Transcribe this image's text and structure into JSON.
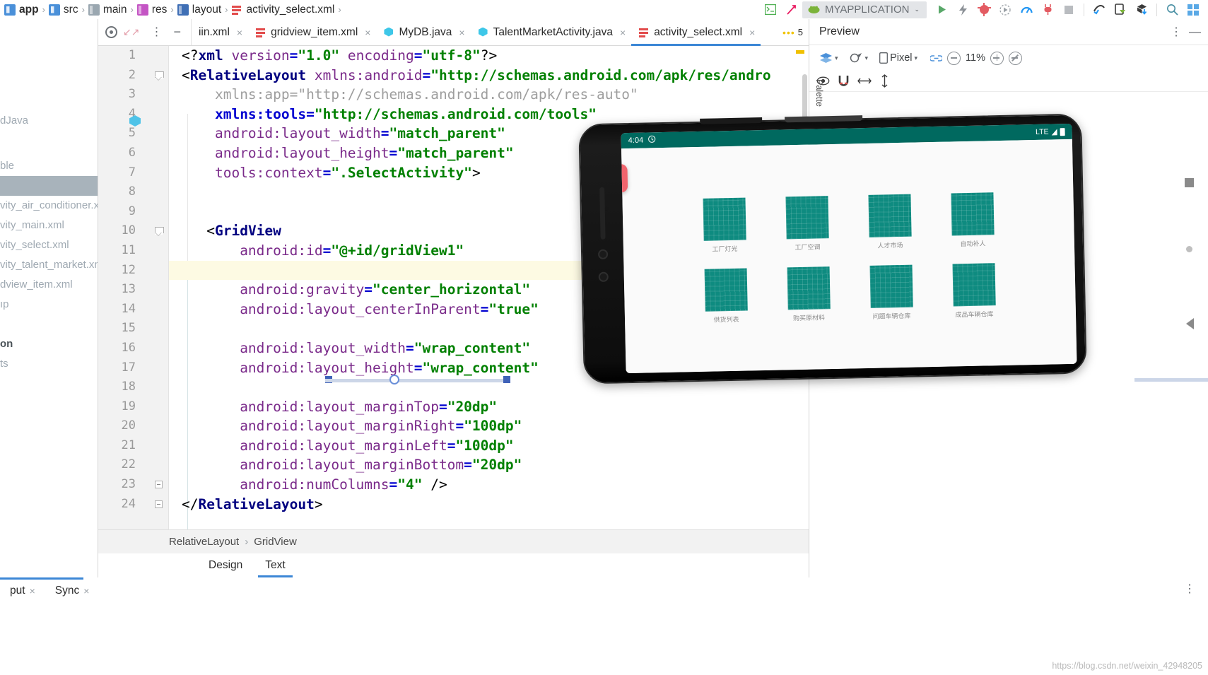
{
  "breadcrumb": {
    "items": [
      {
        "label": "app",
        "icon": "module-icon",
        "bold": true
      },
      {
        "label": "src",
        "icon": "module-icon",
        "bold": false
      },
      {
        "label": "main",
        "icon": "folder-icon",
        "bold": false
      },
      {
        "label": "res",
        "icon": "res-folder-icon",
        "bold": false
      },
      {
        "label": "layout",
        "icon": "layout-folder-icon",
        "bold": false
      },
      {
        "label": "activity_select.xml",
        "icon": "xml-file-icon",
        "bold": false
      }
    ],
    "separator": "›"
  },
  "toolbar": {
    "run_config_name": "MYAPPLICATION",
    "dropdown_caret": "⌄",
    "icons": [
      "terminal-icon",
      "build-icon",
      "android-icon",
      "run-icon",
      "apply-changes-icon",
      "debug-icon",
      "profile-icon",
      "attach-debugger-icon",
      "stop-icon",
      "sdk-manager-icon",
      "avd-manager-icon",
      "sync-gradle-icon",
      "search-icon",
      "layout-inspector-icon"
    ]
  },
  "sidebar": {
    "items": [
      {
        "label": "dJava",
        "selected": false,
        "bold": false
      },
      {
        "label": "",
        "selected": false,
        "bold": false
      },
      {
        "label": "ble",
        "selected": false,
        "bold": false
      },
      {
        "label": "",
        "selected": true,
        "bold": false
      },
      {
        "label": "vity_air_conditioner.x",
        "selected": false,
        "bold": false
      },
      {
        "label": "vity_main.xml",
        "selected": false,
        "bold": false
      },
      {
        "label": "vity_select.xml",
        "selected": false,
        "bold": false
      },
      {
        "label": "vity_talent_market.xn",
        "selected": false,
        "bold": false
      },
      {
        "label": "dview_item.xml",
        "selected": false,
        "bold": false
      },
      {
        "label": "ıp",
        "selected": false,
        "bold": false
      },
      {
        "label": "",
        "selected": false,
        "bold": false
      },
      {
        "label": "on",
        "selected": false,
        "bold": true
      },
      {
        "label": "ts",
        "selected": false,
        "bold": false
      }
    ]
  },
  "editor": {
    "tabs": [
      {
        "label": "iin.xml",
        "icon": "xml-file-icon",
        "active": false,
        "close": "×"
      },
      {
        "label": "gridview_item.xml",
        "icon": "xml-file-icon",
        "active": false,
        "close": "×"
      },
      {
        "label": "MyDB.java",
        "icon": "java-file-icon",
        "active": false,
        "close": "×"
      },
      {
        "label": "TalentMarketActivity.java",
        "icon": "java-file-icon",
        "active": false,
        "close": "×"
      },
      {
        "label": "activity_select.xml",
        "icon": "xml-file-icon",
        "active": true,
        "close": "×"
      }
    ],
    "warning_count": "5",
    "warning_dots": "•••",
    "line_numbers": [
      "1",
      "2",
      "3",
      "4",
      "5",
      "6",
      "7",
      "8",
      "9",
      "10",
      "11",
      "12",
      "13",
      "14",
      "15",
      "16",
      "17",
      "18",
      "19",
      "20",
      "21",
      "22",
      "23",
      "24"
    ],
    "lines": [
      {
        "n": 1,
        "highlight": false,
        "html": "<span class=\"tk-pl\">&lt;?</span><span class=\"tk-tag\">xml</span> <span class=\"tk-attr\">version</span><span class=\"tk-eq\">=</span><span class=\"tk-val\">\"1.0\"</span> <span class=\"tk-attr\">encoding</span><span class=\"tk-eq\">=</span><span class=\"tk-val\">\"utf-8\"</span><span class=\"tk-pl\">?&gt;</span>"
      },
      {
        "n": 2,
        "highlight": false,
        "html": "<span class=\"tk-pl\">&lt;</span><span class=\"tk-tag\">RelativeLayout</span> <span class=\"tk-attr\">xmlns:android</span><span class=\"tk-eq\">=</span><span class=\"tk-val\">\"http://schemas.android.com/apk/res/andro</span>"
      },
      {
        "n": 3,
        "highlight": false,
        "html": "    <span class=\"tk-ns\">xmlns:app=\"http://schemas.android.com/apk/res-auto\"</span>"
      },
      {
        "n": 4,
        "highlight": false,
        "html": "    <span class=\"tk-eq\">xmlns:tools</span><span class=\"tk-eq\">=</span><span class=\"tk-val\">\"http://schemas.android.com/tools\"</span>"
      },
      {
        "n": 5,
        "highlight": false,
        "html": "    <span class=\"tk-attr\">android:layout_width</span><span class=\"tk-eq\">=</span><span class=\"tk-val\">\"match_parent\"</span>"
      },
      {
        "n": 6,
        "highlight": false,
        "html": "    <span class=\"tk-attr\">android:layout_height</span><span class=\"tk-eq\">=</span><span class=\"tk-val\">\"match_parent\"</span>"
      },
      {
        "n": 7,
        "highlight": false,
        "html": "    <span class=\"tk-attr\">tools:context</span><span class=\"tk-eq\">=</span><span class=\"tk-val\">\".SelectActivity\"</span><span class=\"tk-pl\">&gt;</span>"
      },
      {
        "n": 8,
        "highlight": false,
        "html": ""
      },
      {
        "n": 9,
        "highlight": false,
        "html": ""
      },
      {
        "n": 10,
        "highlight": false,
        "html": "   <span class=\"tk-pl\">&lt;</span><span class=\"tk-tag\">GridView</span>"
      },
      {
        "n": 11,
        "highlight": false,
        "html": "       <span class=\"tk-attr\">android:id</span><span class=\"tk-eq\">=</span><span class=\"tk-val\">\"@+id/gridView1\"</span>"
      },
      {
        "n": 12,
        "highlight": true,
        "html": ""
      },
      {
        "n": 13,
        "highlight": false,
        "html": "       <span class=\"tk-attr\">android:gravity</span><span class=\"tk-eq\">=</span><span class=\"tk-val\">\"center_horizontal\"</span>"
      },
      {
        "n": 14,
        "highlight": false,
        "html": "       <span class=\"tk-attr\">android:layout_centerInParent</span><span class=\"tk-eq\">=</span><span class=\"tk-val\">\"true\"</span>"
      },
      {
        "n": 15,
        "highlight": false,
        "html": ""
      },
      {
        "n": 16,
        "highlight": false,
        "html": "       <span class=\"tk-attr\">android:layout_width</span><span class=\"tk-eq\">=</span><span class=\"tk-val\">\"wrap_content\"</span>"
      },
      {
        "n": 17,
        "highlight": false,
        "html": "       <span class=\"tk-attr\">android:layout_height</span><span class=\"tk-eq\">=</span><span class=\"tk-val\">\"wrap_content\"</span>"
      },
      {
        "n": 18,
        "highlight": false,
        "html": ""
      },
      {
        "n": 19,
        "highlight": false,
        "html": "       <span class=\"tk-attr\">android:layout_marginTop</span><span class=\"tk-eq\">=</span><span class=\"tk-val\">\"20dp\"</span>"
      },
      {
        "n": 20,
        "highlight": false,
        "html": "       <span class=\"tk-attr\">android:layout_marginRight</span><span class=\"tk-eq\">=</span><span class=\"tk-val\">\"100dp\"</span>"
      },
      {
        "n": 21,
        "highlight": false,
        "html": "       <span class=\"tk-attr\">android:layout_marginLeft</span><span class=\"tk-eq\">=</span><span class=\"tk-val\">\"100dp\"</span>"
      },
      {
        "n": 22,
        "highlight": false,
        "html": "       <span class=\"tk-attr\">android:layout_marginBottom</span><span class=\"tk-eq\">=</span><span class=\"tk-val\">\"20dp\"</span>"
      },
      {
        "n": 23,
        "highlight": false,
        "html": "       <span class=\"tk-attr\">android:numColumns</span><span class=\"tk-eq\">=</span><span class=\"tk-val\">\"4\"</span> <span class=\"tk-pl\">/&gt;</span>"
      },
      {
        "n": 24,
        "highlight": false,
        "html": "<span class=\"tk-pl\">&lt;/</span><span class=\"tk-tag\">RelativeLayout</span><span class=\"tk-pl\">&gt;</span>"
      }
    ],
    "structure_breadcrumb": [
      "RelativeLayout",
      "GridView"
    ],
    "structure_separator": "›",
    "design_tabs": [
      {
        "label": "Design",
        "active": false
      },
      {
        "label": "Text",
        "active": true
      }
    ]
  },
  "preview": {
    "title": "Preview",
    "kebab": "⋮",
    "minimize": "—",
    "toolbar": {
      "layers_label": "",
      "device_label": "Pixel",
      "zoom_level": "11%",
      "zoom_out": "minus-icon",
      "zoom_in": "plus-icon",
      "zoom_reset": "reset-zoom-icon",
      "link_icon": "link-icon"
    },
    "palette_label": "Palette",
    "device_frame": {
      "status_bar": {
        "time": "4:04",
        "notification_icon": "alarm-icon",
        "network": "LTE",
        "signal_icon": "signal-icon",
        "battery_icon": "battery-icon"
      },
      "fab_icon": "search-icon",
      "grid": {
        "columns": 4,
        "items": [
          {
            "label": "工厂灯光"
          },
          {
            "label": "工厂空调"
          },
          {
            "label": "人才市场"
          },
          {
            "label": "自动补人"
          },
          {
            "label": "供货列表"
          },
          {
            "label": "购买原材料"
          },
          {
            "label": "问题车辆仓库"
          },
          {
            "label": "成品车辆仓库"
          }
        ]
      }
    }
  },
  "bottom_bar": {
    "tabs": [
      {
        "label": "put",
        "close": "×",
        "active": true
      },
      {
        "label": "Sync",
        "close": "×",
        "active": false
      }
    ],
    "kebab": "⋮",
    "watermark": "https://blog.csdn.net/weixin_42948205"
  },
  "colors": {
    "accent_blue": "#3c87d6",
    "teal_tile": "#0e8b80",
    "status_bar_teal": "#00695f",
    "fab_red": "#f0646d",
    "highlight_line": "#fdfae3"
  }
}
